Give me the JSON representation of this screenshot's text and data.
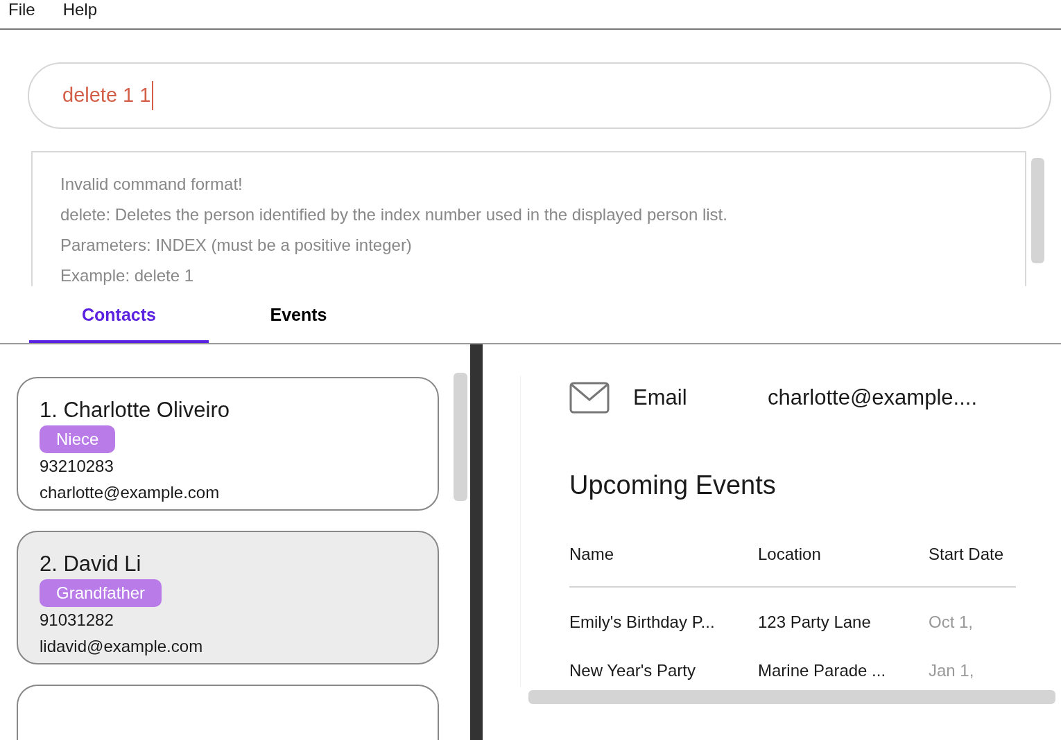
{
  "menu": [
    "File",
    "Help"
  ],
  "command": {
    "value": "delete 1 1"
  },
  "result": [
    "Invalid command format!",
    "delete: Deletes the person identified by the index number used in the displayed person list.",
    "Parameters: INDEX (must be a positive integer)",
    "Example: delete 1"
  ],
  "tabs": [
    {
      "label": "Contacts",
      "selected": true
    },
    {
      "label": "Events",
      "selected": false
    }
  ],
  "contacts": [
    {
      "name": "1. Charlotte Oliveiro",
      "tag": "Niece",
      "phone": "93210283",
      "email": "charlotte@example.com",
      "selected": false
    },
    {
      "name": "2. David Li",
      "tag": "Grandfather",
      "phone": "91031282",
      "email": "lidavid@example.com",
      "selected": true
    }
  ],
  "detail": {
    "email_label": "Email",
    "email_value": "charlotte@example....",
    "heading": "Upcoming Events",
    "table": {
      "columns": [
        "Name",
        "Location",
        "Start Date"
      ],
      "rows": [
        [
          "Emily's Birthday P...",
          "123 Party Lane",
          "Oct 1,"
        ],
        [
          "New Year's Party",
          "Marine Parade ...",
          "Jan 1,"
        ]
      ]
    }
  }
}
